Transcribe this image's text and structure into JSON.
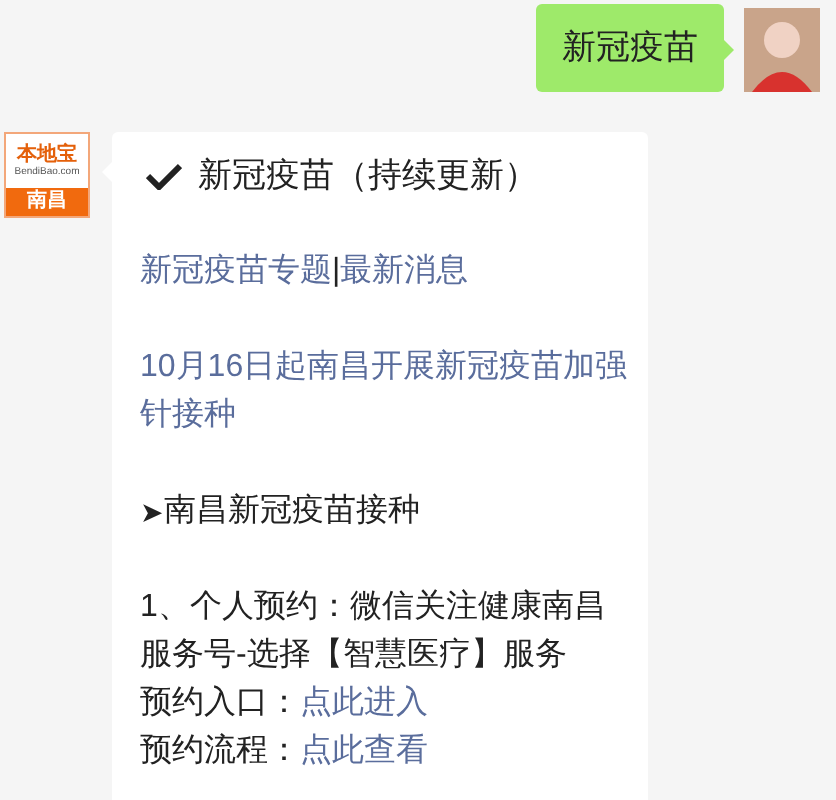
{
  "sent_message": {
    "text": "新冠疫苗"
  },
  "sender_logo": {
    "brand": "本地宝",
    "site": "BendiBao.com",
    "city": "南昌"
  },
  "reply": {
    "title": "新冠疫苗（持续更新）",
    "links_row": {
      "first": "新冠疫苗专题",
      "separator": "|",
      "second": "最新消息"
    },
    "news_link": "10月16日起南昌开展新冠疫苗加强针接种",
    "section": {
      "marker": "➤",
      "text": "南昌新冠疫苗接种"
    },
    "step": "1、个人预约：微信关注健康南昌服务号-选择【智慧医疗】服务",
    "entries": [
      {
        "label": "预约入口：",
        "link": "点此进入"
      },
      {
        "label": "预约流程：",
        "link": "点此查看"
      }
    ]
  }
}
